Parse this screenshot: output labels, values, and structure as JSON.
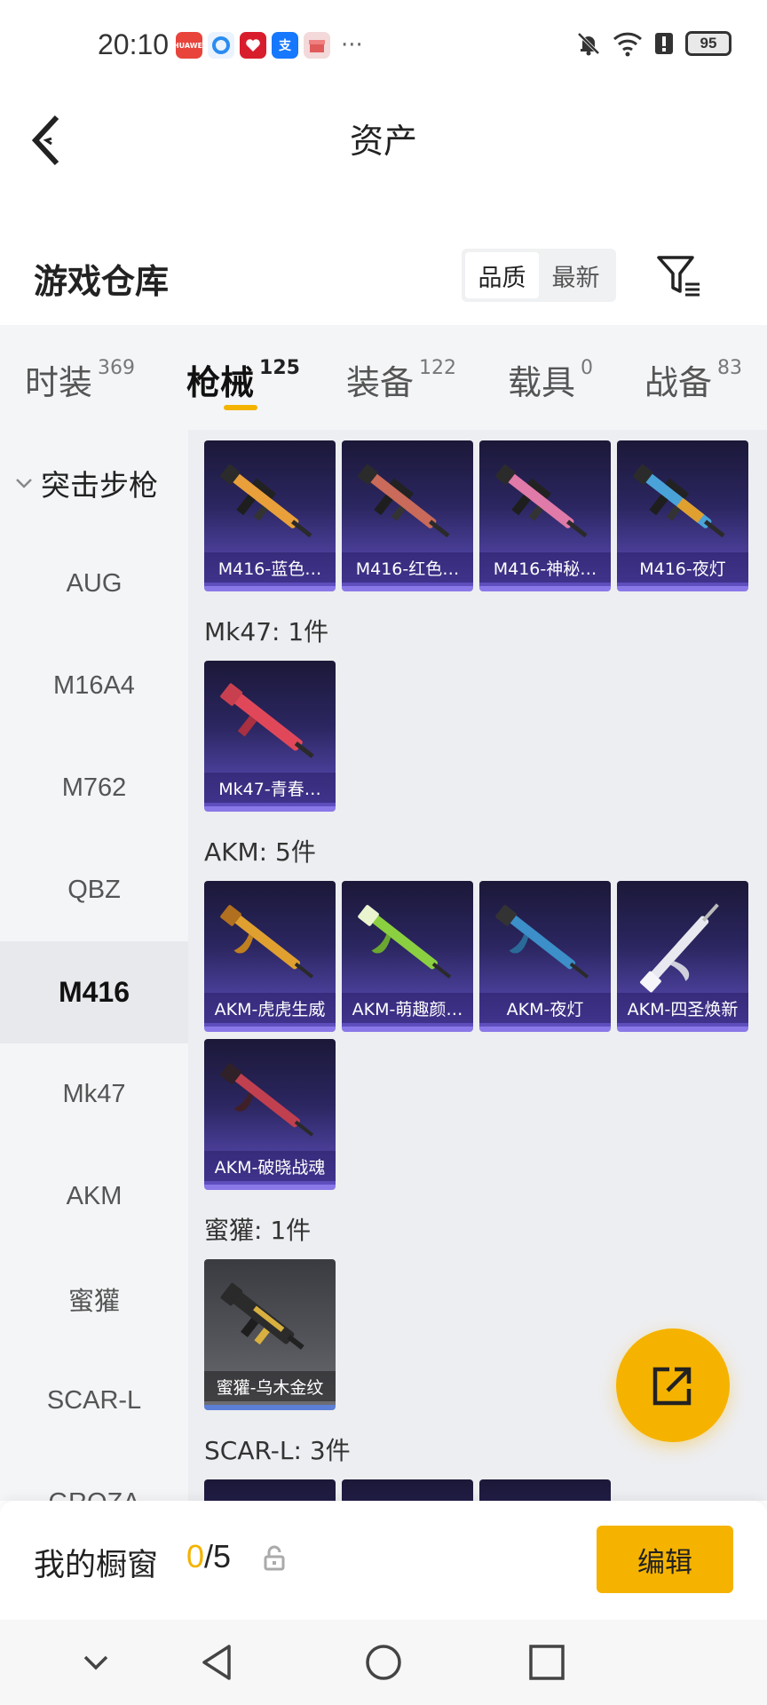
{
  "status_bar": {
    "time": "20:10",
    "more": "···",
    "battery": "95",
    "app_icons": [
      {
        "name": "huawei-icon",
        "color": "#e8443b",
        "text": ""
      },
      {
        "name": "browser-icon",
        "color": "#2a8cf0",
        "text": ""
      },
      {
        "name": "heart-app-icon",
        "color": "#d81e2c",
        "text": ""
      },
      {
        "name": "alipay-icon",
        "color": "#1677ff",
        "text": "支"
      },
      {
        "name": "gift-box-icon",
        "color": "#e05a5a",
        "text": ""
      }
    ]
  },
  "header": {
    "title": "资产"
  },
  "warehouse": {
    "title": "游戏仓库",
    "sort_options": [
      "品质",
      "最新"
    ],
    "active_sort": "品质"
  },
  "tabs": [
    {
      "label": "时装",
      "count": "369"
    },
    {
      "label": "枪械",
      "count": "125",
      "active": true
    },
    {
      "label": "装备",
      "count": "122"
    },
    {
      "label": "载具",
      "count": "0"
    },
    {
      "label": "战备",
      "count": "83"
    }
  ],
  "sidebar": {
    "category": "突击步枪",
    "items": [
      "AUG",
      "M16A4",
      "M762",
      "QBZ",
      "M416",
      "Mk47",
      "AKM",
      "蜜獾",
      "SCAR-L",
      "GROZA"
    ],
    "active": "M416"
  },
  "content": {
    "groups": [
      {
        "label": "",
        "items": [
          {
            "name": "M416-蓝色…",
            "accent": "#e9a03a"
          },
          {
            "name": "M416-红色…",
            "accent": "#c96a5a"
          },
          {
            "name": "M416-神秘…",
            "accent": "#e07aa8"
          },
          {
            "name": "M416-夜灯",
            "accent": "#4aa3d8"
          }
        ]
      },
      {
        "label": "Mk47: 1件",
        "items": [
          {
            "name": "Mk47-青春…",
            "accent": "#e0485a"
          }
        ]
      },
      {
        "label": "AKM: 5件",
        "items": [
          {
            "name": "AKM-虎虎生威",
            "accent": "#e0a030"
          },
          {
            "name": "AKM-萌趣颜…",
            "accent": "#8bd040"
          },
          {
            "name": "AKM-夜灯",
            "accent": "#3c8fc8"
          },
          {
            "name": "AKM-四圣焕新",
            "accent": "#e8e8f0"
          },
          {
            "name": "AKM-破晓战魂",
            "accent": "#c04050"
          }
        ]
      },
      {
        "label": "蜜獾: 1件",
        "items": [
          {
            "name": "蜜獾-乌木金纹",
            "accent": "#d8b040"
          }
        ]
      },
      {
        "label": "SCAR-L: 3件",
        "items": [
          {
            "name": "",
            "accent": "#6a5acd"
          },
          {
            "name": "",
            "accent": "#6a5acd"
          },
          {
            "name": "",
            "accent": "#6a5acd"
          }
        ]
      }
    ]
  },
  "showcase": {
    "label": "我的橱窗",
    "current": "0",
    "total": "/5",
    "edit_label": "编辑"
  }
}
